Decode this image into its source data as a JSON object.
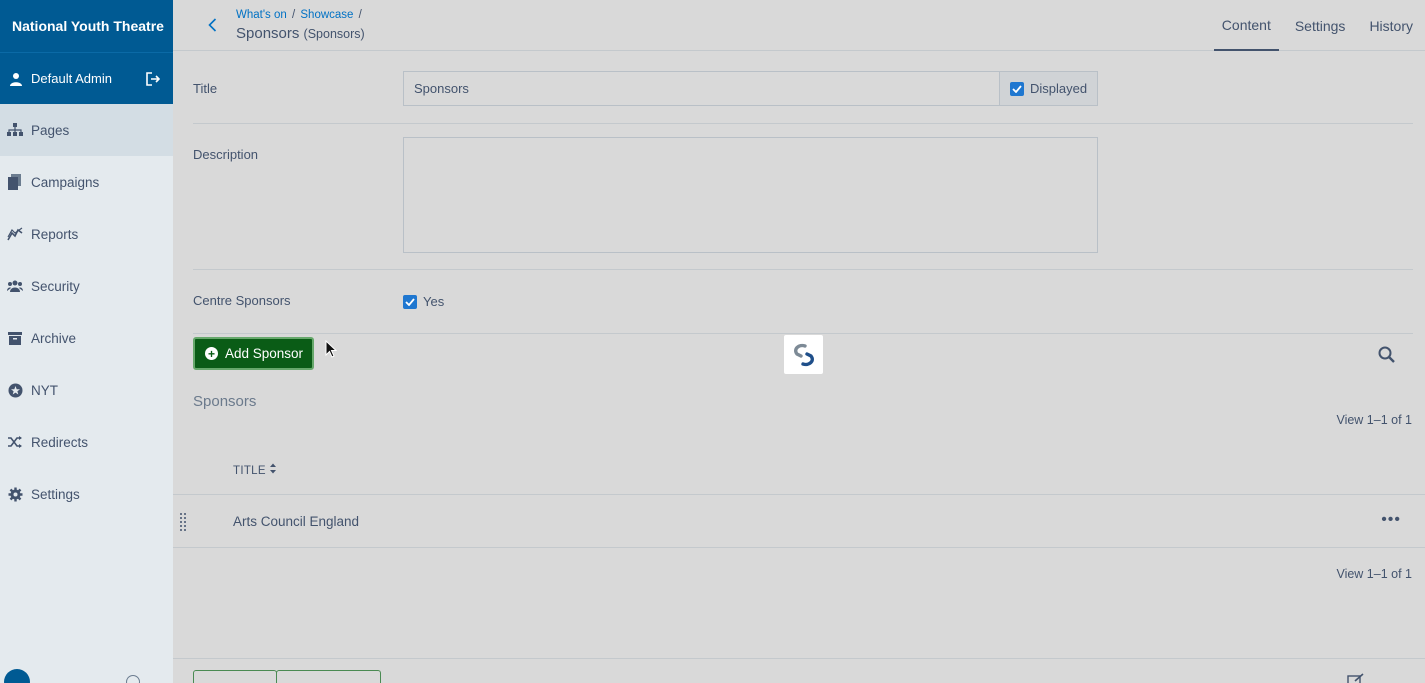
{
  "sidebar": {
    "brand": "National Youth Theatre",
    "user": {
      "name": "Default Admin"
    },
    "items": [
      {
        "label": "Pages",
        "icon": "sitemap-icon",
        "active": true
      },
      {
        "label": "Campaigns",
        "icon": "copy-icon",
        "active": false
      },
      {
        "label": "Reports",
        "icon": "chart-line-icon",
        "active": false
      },
      {
        "label": "Security",
        "icon": "users-icon",
        "active": false
      },
      {
        "label": "Archive",
        "icon": "archive-icon",
        "active": false
      },
      {
        "label": "NYT",
        "icon": "star-circle-icon",
        "active": false
      },
      {
        "label": "Redirects",
        "icon": "random-icon",
        "active": false
      },
      {
        "label": "Settings",
        "icon": "gear-icon",
        "active": false
      }
    ]
  },
  "header": {
    "breadcrumbs": [
      "What's on",
      "Showcase"
    ],
    "title": "Sponsors",
    "subtitle": "(Sponsors)",
    "tabs": [
      {
        "label": "Content",
        "active": true
      },
      {
        "label": "Settings",
        "active": false
      },
      {
        "label": "History",
        "active": false
      }
    ]
  },
  "form": {
    "title_label": "Title",
    "title_value": "Sponsors",
    "displayed_label": "Displayed",
    "displayed_checked": true,
    "description_label": "Description",
    "description_value": "",
    "centre_sponsors_label": "Centre Sponsors",
    "centre_sponsors_option": "Yes",
    "centre_sponsors_checked": true
  },
  "grid": {
    "add_button": "Add Sponsor",
    "title": "Sponsors",
    "count_text": "View 1–1 of 1",
    "column_title": "TITLE",
    "rows": [
      {
        "title": "Arts Council England"
      }
    ]
  },
  "colors": {
    "brand": "#005a93",
    "add_button": "#0a5c16",
    "link": "#0071c4",
    "checkbox": "#1f77d0"
  }
}
